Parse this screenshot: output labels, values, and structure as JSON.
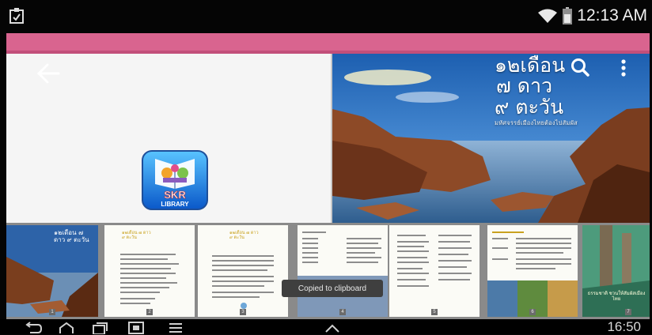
{
  "status_bar": {
    "time": "12:13 AM",
    "icons": [
      "clipboard-icon",
      "wifi-icon",
      "battery-icon"
    ]
  },
  "reader": {
    "back_icon": "arrow-left-icon",
    "logo": {
      "text_top": "SKR",
      "text_bottom": "LIBRARY"
    },
    "cover": {
      "title_line1": "๑๒เดือน",
      "title_line2": "๗ ดาว",
      "title_line3": "๙ ตะวัน",
      "subtitle": "มหัศจรรย์เมืองไทยต้องไปสัมผัส"
    },
    "toolbar_icons": [
      "search-icon",
      "more-vert-icon"
    ]
  },
  "thumbnails": [
    {
      "page": "1",
      "kind": "cover"
    },
    {
      "page": "2",
      "kind": "text"
    },
    {
      "page": "3",
      "kind": "text"
    },
    {
      "page": "4",
      "kind": "text"
    },
    {
      "page": "5",
      "kind": "text"
    },
    {
      "page": "6",
      "kind": "photo"
    },
    {
      "page": "7",
      "kind": "photo"
    }
  ],
  "thumb_title": "๑๒เดือน ๗ ดาว ๙ ตะวัน",
  "thumb7_caption": "ธรรมชาติ ชวนให้สัมผัสเมืองไทย",
  "toast": "Copied to clipboard",
  "nav_bar": {
    "icons": [
      "back-icon",
      "home-icon",
      "recents-icon",
      "screenshot-icon",
      "menu-icon",
      "up-chevron-icon"
    ],
    "time": "16:50"
  }
}
